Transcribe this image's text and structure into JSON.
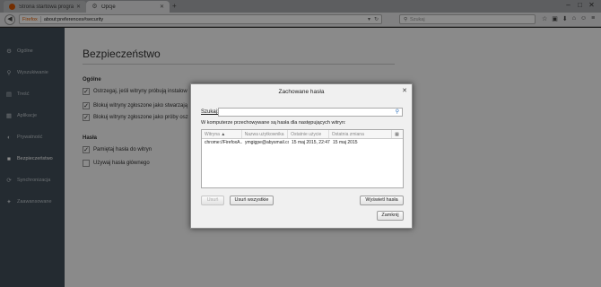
{
  "tabs": [
    {
      "label": "Strona startowa programu Fi...",
      "active": false
    },
    {
      "label": "Opcje",
      "active": true
    }
  ],
  "new_tab_label": "+",
  "window_controls": {
    "minimize": "–",
    "maximize": "□",
    "close": "✕"
  },
  "urlbar": {
    "brand": "Firefox",
    "url": "about:preferences#security"
  },
  "searchbar": {
    "placeholder": "Szukaj"
  },
  "sidebar": {
    "items": [
      {
        "label": "Ogólne",
        "icon": "gear-icon",
        "glyph": "⚙"
      },
      {
        "label": "Wyszukiwanie",
        "icon": "search-icon",
        "glyph": "⚲"
      },
      {
        "label": "Treść",
        "icon": "document-icon",
        "glyph": "▤"
      },
      {
        "label": "Aplikacje",
        "icon": "apps-icon",
        "glyph": "▦"
      },
      {
        "label": "Prywatność",
        "icon": "mask-icon",
        "glyph": "◐"
      },
      {
        "label": "Bezpieczeństwo",
        "icon": "lock-icon",
        "glyph": "■",
        "selected": true
      },
      {
        "label": "Synchronizacja",
        "icon": "sync-icon",
        "glyph": "⟳"
      },
      {
        "label": "Zaawansowane",
        "icon": "wizard-icon",
        "glyph": "✦"
      }
    ]
  },
  "main": {
    "title": "Bezpieczeństwo",
    "general_section": "Ogólne",
    "options": [
      {
        "label": "Ostrzegaj, jeśli witryny próbują instalow",
        "checked": true
      },
      {
        "label": "Blokuj witryny zgłoszone jako stwarzają",
        "checked": true
      },
      {
        "label": "Blokuj witryny zgłoszone jako próby osz",
        "checked": true
      }
    ],
    "passwords_section": "Hasła",
    "password_options": [
      {
        "label": "Pamiętaj hasła do witryn",
        "checked": true
      },
      {
        "label": "Używaj hasła głównego",
        "checked": false
      }
    ]
  },
  "dialog": {
    "title": "Zachowane hasła",
    "close": "✕",
    "search_label": "Szukaj:",
    "search_value": "",
    "description": "W komputerze przechowywane są hasła dla następujących witryn:",
    "columns": [
      "Witryna",
      "Nazwa użytkownika",
      "Ostatnie użycie",
      "Ostatnia zmiana",
      ""
    ],
    "sort_indicator": "▲",
    "rows": [
      {
        "site": "chrome://FirefoxA...",
        "user": "ymgigpe@abysmail.com",
        "last_used": "15 maj 2015, 22:47",
        "last_changed": "15 maj 2015"
      }
    ],
    "buttons": {
      "remove": "Usuń",
      "remove_all": "Usuń wszystkie",
      "show_passwords": "Wyświetl hasła",
      "close": "Zamknij"
    }
  }
}
